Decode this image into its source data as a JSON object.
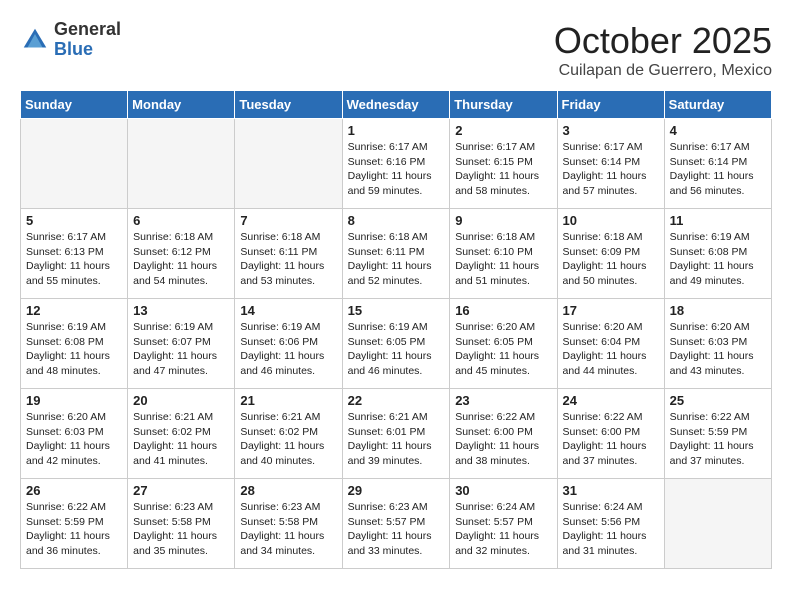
{
  "header": {
    "logo_general": "General",
    "logo_blue": "Blue",
    "month": "October 2025",
    "subtitle": "Cuilapan de Guerrero, Mexico"
  },
  "days_of_week": [
    "Sunday",
    "Monday",
    "Tuesday",
    "Wednesday",
    "Thursday",
    "Friday",
    "Saturday"
  ],
  "weeks": [
    [
      {
        "day": "",
        "text": ""
      },
      {
        "day": "",
        "text": ""
      },
      {
        "day": "",
        "text": ""
      },
      {
        "day": "1",
        "text": "Sunrise: 6:17 AM\nSunset: 6:16 PM\nDaylight: 11 hours and 59 minutes."
      },
      {
        "day": "2",
        "text": "Sunrise: 6:17 AM\nSunset: 6:15 PM\nDaylight: 11 hours and 58 minutes."
      },
      {
        "day": "3",
        "text": "Sunrise: 6:17 AM\nSunset: 6:14 PM\nDaylight: 11 hours and 57 minutes."
      },
      {
        "day": "4",
        "text": "Sunrise: 6:17 AM\nSunset: 6:14 PM\nDaylight: 11 hours and 56 minutes."
      }
    ],
    [
      {
        "day": "5",
        "text": "Sunrise: 6:17 AM\nSunset: 6:13 PM\nDaylight: 11 hours and 55 minutes."
      },
      {
        "day": "6",
        "text": "Sunrise: 6:18 AM\nSunset: 6:12 PM\nDaylight: 11 hours and 54 minutes."
      },
      {
        "day": "7",
        "text": "Sunrise: 6:18 AM\nSunset: 6:11 PM\nDaylight: 11 hours and 53 minutes."
      },
      {
        "day": "8",
        "text": "Sunrise: 6:18 AM\nSunset: 6:11 PM\nDaylight: 11 hours and 52 minutes."
      },
      {
        "day": "9",
        "text": "Sunrise: 6:18 AM\nSunset: 6:10 PM\nDaylight: 11 hours and 51 minutes."
      },
      {
        "day": "10",
        "text": "Sunrise: 6:18 AM\nSunset: 6:09 PM\nDaylight: 11 hours and 50 minutes."
      },
      {
        "day": "11",
        "text": "Sunrise: 6:19 AM\nSunset: 6:08 PM\nDaylight: 11 hours and 49 minutes."
      }
    ],
    [
      {
        "day": "12",
        "text": "Sunrise: 6:19 AM\nSunset: 6:08 PM\nDaylight: 11 hours and 48 minutes."
      },
      {
        "day": "13",
        "text": "Sunrise: 6:19 AM\nSunset: 6:07 PM\nDaylight: 11 hours and 47 minutes."
      },
      {
        "day": "14",
        "text": "Sunrise: 6:19 AM\nSunset: 6:06 PM\nDaylight: 11 hours and 46 minutes."
      },
      {
        "day": "15",
        "text": "Sunrise: 6:19 AM\nSunset: 6:05 PM\nDaylight: 11 hours and 46 minutes."
      },
      {
        "day": "16",
        "text": "Sunrise: 6:20 AM\nSunset: 6:05 PM\nDaylight: 11 hours and 45 minutes."
      },
      {
        "day": "17",
        "text": "Sunrise: 6:20 AM\nSunset: 6:04 PM\nDaylight: 11 hours and 44 minutes."
      },
      {
        "day": "18",
        "text": "Sunrise: 6:20 AM\nSunset: 6:03 PM\nDaylight: 11 hours and 43 minutes."
      }
    ],
    [
      {
        "day": "19",
        "text": "Sunrise: 6:20 AM\nSunset: 6:03 PM\nDaylight: 11 hours and 42 minutes."
      },
      {
        "day": "20",
        "text": "Sunrise: 6:21 AM\nSunset: 6:02 PM\nDaylight: 11 hours and 41 minutes."
      },
      {
        "day": "21",
        "text": "Sunrise: 6:21 AM\nSunset: 6:02 PM\nDaylight: 11 hours and 40 minutes."
      },
      {
        "day": "22",
        "text": "Sunrise: 6:21 AM\nSunset: 6:01 PM\nDaylight: 11 hours and 39 minutes."
      },
      {
        "day": "23",
        "text": "Sunrise: 6:22 AM\nSunset: 6:00 PM\nDaylight: 11 hours and 38 minutes."
      },
      {
        "day": "24",
        "text": "Sunrise: 6:22 AM\nSunset: 6:00 PM\nDaylight: 11 hours and 37 minutes."
      },
      {
        "day": "25",
        "text": "Sunrise: 6:22 AM\nSunset: 5:59 PM\nDaylight: 11 hours and 37 minutes."
      }
    ],
    [
      {
        "day": "26",
        "text": "Sunrise: 6:22 AM\nSunset: 5:59 PM\nDaylight: 11 hours and 36 minutes."
      },
      {
        "day": "27",
        "text": "Sunrise: 6:23 AM\nSunset: 5:58 PM\nDaylight: 11 hours and 35 minutes."
      },
      {
        "day": "28",
        "text": "Sunrise: 6:23 AM\nSunset: 5:58 PM\nDaylight: 11 hours and 34 minutes."
      },
      {
        "day": "29",
        "text": "Sunrise: 6:23 AM\nSunset: 5:57 PM\nDaylight: 11 hours and 33 minutes."
      },
      {
        "day": "30",
        "text": "Sunrise: 6:24 AM\nSunset: 5:57 PM\nDaylight: 11 hours and 32 minutes."
      },
      {
        "day": "31",
        "text": "Sunrise: 6:24 AM\nSunset: 5:56 PM\nDaylight: 11 hours and 31 minutes."
      },
      {
        "day": "",
        "text": ""
      }
    ]
  ]
}
